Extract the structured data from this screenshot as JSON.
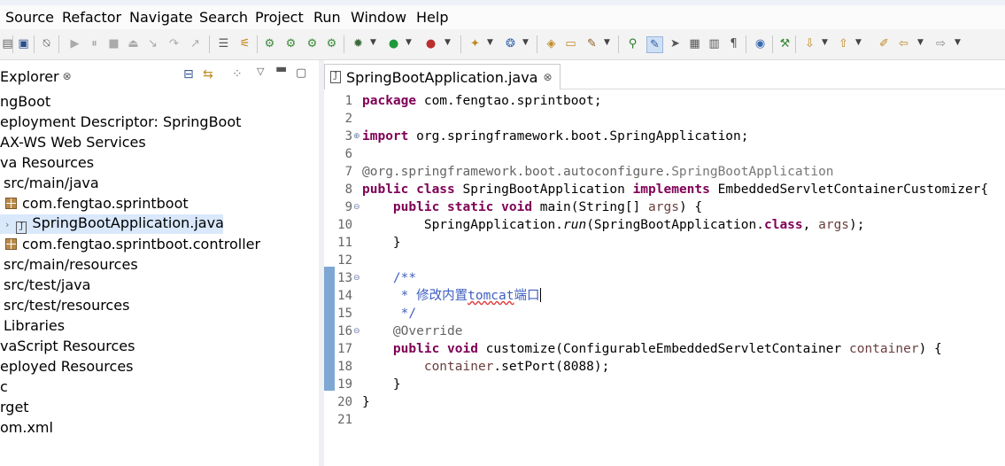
{
  "menu": [
    "Source",
    "Refactor",
    "Navigate",
    "Search",
    "Project",
    "Run",
    "Window",
    "Help"
  ],
  "explorer": {
    "title": "Explorer",
    "close": "⊗",
    "items": [
      {
        "label": "ngBoot"
      },
      {
        "label": "eployment Descriptor: SpringBoot"
      },
      {
        "label": "AX-WS Web Services"
      },
      {
        "label": "va Resources"
      },
      {
        "label": "src/main/java"
      },
      {
        "label": "com.fengtao.sprintboot"
      },
      {
        "label": "SpringBootApplication.java"
      },
      {
        "label": "com.fengtao.sprintboot.controller"
      },
      {
        "label": "src/main/resources"
      },
      {
        "label": "src/test/java"
      },
      {
        "label": "src/test/resources"
      },
      {
        "label": "Libraries"
      },
      {
        "label": "vaScript Resources"
      },
      {
        "label": "eployed Resources"
      },
      {
        "label": "c"
      },
      {
        "label": "rget"
      },
      {
        "label": "om.xml"
      }
    ]
  },
  "editor": {
    "tab_label": "SpringBootApplication.java",
    "tab_close": "⊗",
    "line_numbers": [
      "1",
      "2",
      "3",
      "6",
      "7",
      "8",
      "9",
      "10",
      "11",
      "12",
      "13",
      "14",
      "15",
      "16",
      "17",
      "18",
      "19",
      "20",
      "21"
    ],
    "code": {
      "l1_kw": "package",
      "l1_rest": " com.fengtao.sprintboot;",
      "l3_kw": "import",
      "l3_rest": " org.springframework.boot.SpringApplication;",
      "l7_a": "@org.springframework.boot.autoconfigure.",
      "l7_b": "SpringBootApplication",
      "l8_kw1": "public class",
      "l8_mid": " SpringBootApplication ",
      "l8_kw2": "implements",
      "l8_rest": " EmbeddedServletContainerCustomizer{",
      "l9_indent": "    ",
      "l9_kw": "public static void",
      "l9_mid": " main(String[] ",
      "l9_param": "args",
      "l9_rest": ") {",
      "l10_indent": "        ",
      "l10_a": "SpringApplication.",
      "l10_b": "run",
      "l10_c": "(SpringBootApplication.",
      "l10_kw": "class",
      "l10_d": ", ",
      "l10_param": "args",
      "l10_e": ");",
      "l11": "    }",
      "l13": "    /**",
      "l14_a": "     * 修改内置",
      "l14_b": "tomcat",
      "l14_c": "端口",
      "l15": "     */",
      "l16": "    @Override",
      "l17_indent": "    ",
      "l17_kw": "public void",
      "l17_mid": " customize(ConfigurableEmbeddedServletContainer ",
      "l17_param": "container",
      "l17_rest": ") {",
      "l18_indent": "        ",
      "l18_param": "container",
      "l18_rest": ".setPort(8088);",
      "l19": "    }",
      "l20": "}"
    }
  },
  "colors": {
    "keyword": "#7f0055",
    "comment": "#3f5fbf",
    "annotation": "#646464",
    "selection": "#d9e8fb"
  },
  "icons": [
    "save-icon",
    "print-icon",
    "debug-icon",
    "run-icon",
    "search-icon",
    "back-icon",
    "forward-icon"
  ]
}
